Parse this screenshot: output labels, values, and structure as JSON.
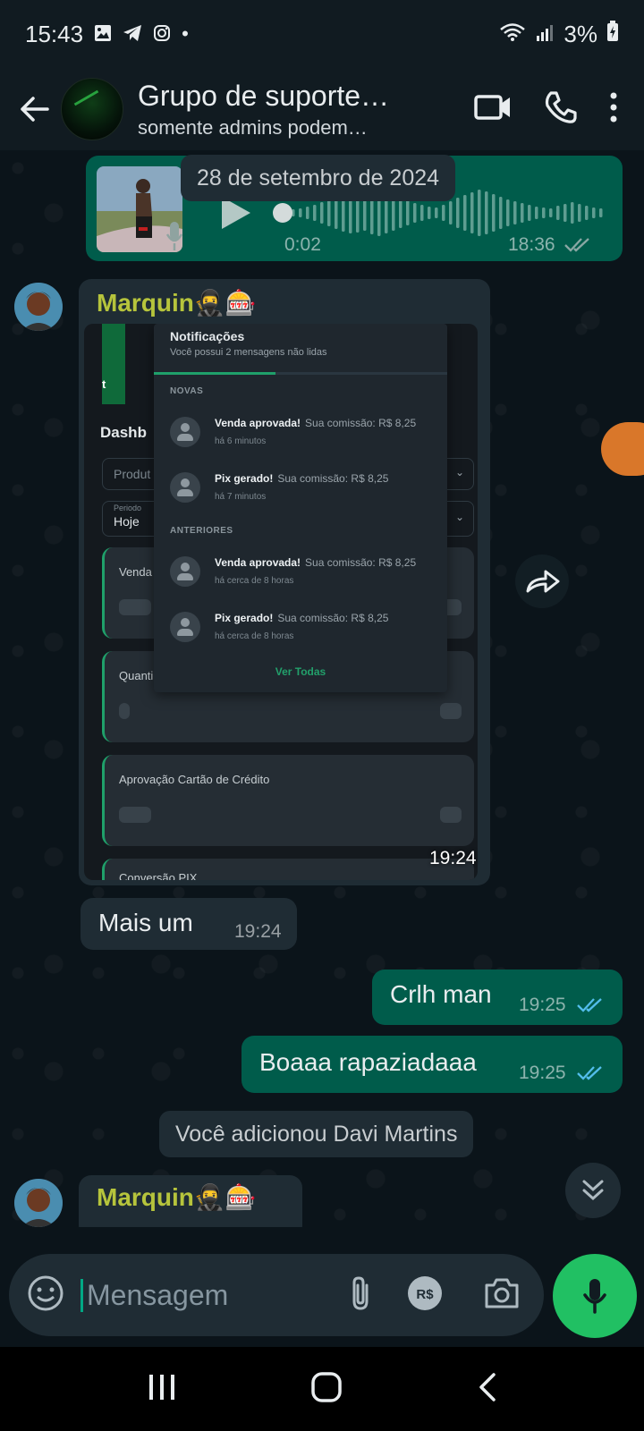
{
  "status_bar": {
    "time": "15:43",
    "battery": "3%"
  },
  "header": {
    "title": "Grupo de suporte…",
    "subtitle": "somente admins podem…"
  },
  "messages": {
    "date_divider": "28 de setembro de 2024",
    "audio": {
      "duration": "0:02",
      "time": "18:36",
      "progress": 0.0
    },
    "image_msg": {
      "sender": "Marquin🥷🎰",
      "time": "19:24"
    },
    "text_in_1": {
      "text": "Mais um",
      "time": "19:24"
    },
    "text_out_1": {
      "text": "Crlh man",
      "time": "19:25"
    },
    "text_out_2": {
      "text": "Boaaa rapaziadaaa",
      "time": "19:25"
    },
    "system": "Você adicionou Davi Martins",
    "last_sender": "Marquin🥷🎰"
  },
  "screenshot": {
    "dash_partial": "Dashb",
    "produto_partial": "Produt",
    "periodo_label": "Periodo",
    "periodo_value": "Hoje",
    "tab_partial": "t",
    "notifications": {
      "title": "Notificações",
      "subtitle": "Você possui 2 mensagens não lidas",
      "section_new": "NOVAS",
      "section_old": "ANTERIORES",
      "items": [
        {
          "title": "Venda aprovada!",
          "text": "Sua comissão: R$ 8,25",
          "when": "há 6 minutos"
        },
        {
          "title": "Pix gerado!",
          "text": "Sua comissão: R$ 8,25",
          "when": "há 7 minutos"
        },
        {
          "title": "Venda aprovada!",
          "text": "Sua comissão: R$ 8,25",
          "when": "há cerca de 8 horas"
        },
        {
          "title": "Pix gerado!",
          "text": "Sua comissão: R$ 8,25",
          "when": "há cerca de 8 horas"
        }
      ],
      "see_all": "Ver Todas"
    },
    "cards": [
      "Venda",
      "Quanti",
      "Aprovação Cartão de Crédito",
      "Conversão PIX"
    ]
  },
  "input": {
    "placeholder": "Mensagem"
  },
  "colors": {
    "accent": "#00a884",
    "outgoing": "#005c4b",
    "incoming": "#1f2c34",
    "sender_name": "#b6c43c",
    "read_ticks": "#53bdeb"
  }
}
